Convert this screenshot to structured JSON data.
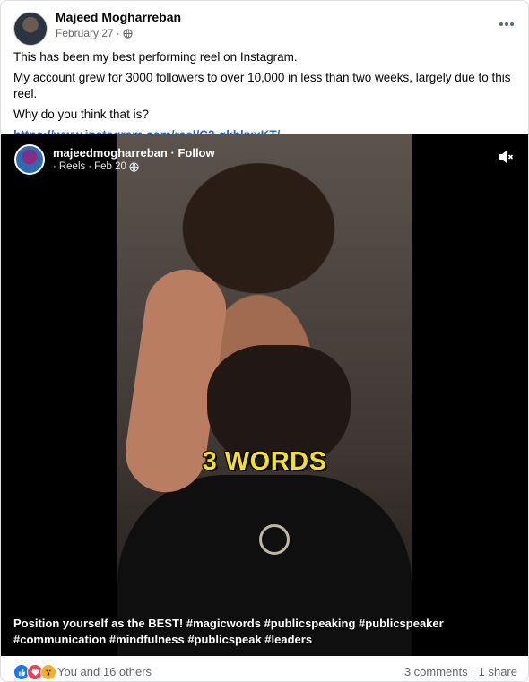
{
  "post": {
    "author": "Majeed Mogharreban",
    "date": "February 27",
    "privacy_icon": "globe-icon",
    "more_icon": "more-horizontal-icon",
    "text": {
      "line1": "This has been my best performing reel on Instagram.",
      "line2": "My account grew for 3000 followers to over 10,000 in less than two weeks, largely due to this reel.",
      "line3": "Why do you think that is?",
      "link": "https://www.instagram.com/reel/C2-gkbkxxKT/..."
    }
  },
  "reel": {
    "username": "majeedmogharreban",
    "follow_label": "Follow",
    "source": "Reels",
    "date": "Feb 20",
    "overlay_text": "3 WORDS",
    "caption_line1": "Position yourself as the BEST! #magicwords #publicspeaking #publicspeaker",
    "caption_line2": "#communication #mindfulness #publicspeak #leaders",
    "mute_icon": "speaker-muted-icon"
  },
  "footer": {
    "reactions_text": "You and 16 others",
    "comments": "3 comments",
    "shares": "1 share",
    "reaction_icons": [
      "like-icon",
      "love-icon",
      "wow-icon"
    ]
  },
  "colors": {
    "link": "#216fdb",
    "muted_text": "#65676b",
    "overlay_yellow": "#f6e21c",
    "like_blue": "#1877f2",
    "love_red": "#f33e58",
    "wow_yellow": "#f7b125"
  }
}
